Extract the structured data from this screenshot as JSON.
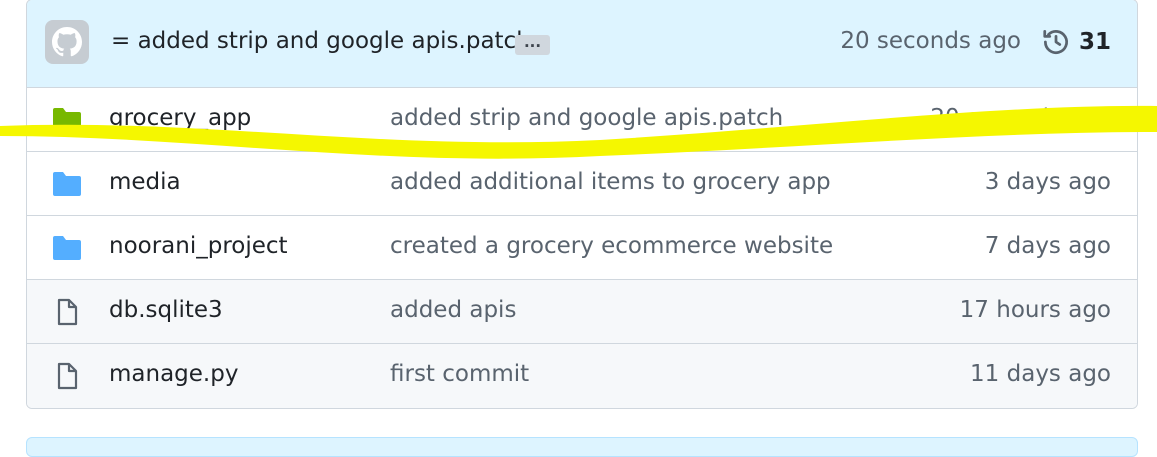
{
  "latest_commit": {
    "avatar_icon": "github-avatar-icon",
    "message": "= added strip and google apis.patch",
    "ellipsis": "...",
    "time": "20 seconds ago",
    "history_icon": "history-icon",
    "commit_count": "31"
  },
  "files": [
    {
      "type": "folder",
      "icon": "folder-icon",
      "name": "grocery_app",
      "message": "added strip and google apis.patch",
      "time": "20 seconds ago",
      "color": "#77b800"
    },
    {
      "type": "folder",
      "icon": "folder-icon",
      "name": "media",
      "message": "added additional items to grocery app",
      "time": "3 days ago",
      "color": "#54aeff"
    },
    {
      "type": "folder",
      "icon": "folder-icon",
      "name": "noorani_project",
      "message": "created a grocery ecommerce website",
      "time": "7 days ago",
      "color": "#54aeff"
    },
    {
      "type": "file",
      "icon": "file-icon",
      "name": "db.sqlite3",
      "message": "added apis",
      "time": "17 hours ago",
      "color": "#59636e"
    },
    {
      "type": "file",
      "icon": "file-icon",
      "name": "manage.py",
      "message": "first commit",
      "time": "11 days ago",
      "color": "#59636e"
    }
  ],
  "highlight_color": "#f5f700"
}
